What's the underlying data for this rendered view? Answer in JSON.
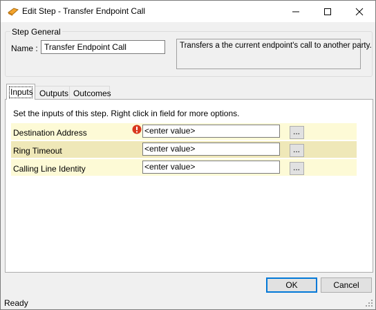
{
  "window": {
    "title": "Edit Step - Transfer Endpoint Call",
    "controls": {
      "minimize": "minimize-icon",
      "maximize": "maximize-icon",
      "close": "close-icon"
    }
  },
  "step_general": {
    "group_label": "Step General",
    "name_label": "Name :",
    "name_value": "Transfer Endpoint Call",
    "description": "Transfers a the current endpoint's call to another party."
  },
  "tabs": [
    {
      "label": "Inputs",
      "selected": true
    },
    {
      "label": "Outputs",
      "selected": false
    },
    {
      "label": "Outcomes",
      "selected": false
    }
  ],
  "inputs": {
    "instruction": "Set the inputs of this step.  Right click in field for more options.",
    "rows": [
      {
        "label": "Destination Address",
        "value": "<enter value>",
        "button": "...",
        "error": true,
        "row_color": "#fdfad6"
      },
      {
        "label": "Ring Timeout",
        "value": "<enter value>",
        "button": "...",
        "error": false,
        "row_color": "#efe8b8"
      },
      {
        "label": "Calling Line Identity",
        "value": "<enter value>",
        "button": "...",
        "error": false,
        "row_color": "#fdfad6"
      }
    ]
  },
  "buttons": {
    "ok": "OK",
    "cancel": "Cancel"
  },
  "status": {
    "text": "Ready"
  },
  "colors": {
    "accent": "#0078d7",
    "error": "#d9381e",
    "title_bar": "#ffffff"
  }
}
